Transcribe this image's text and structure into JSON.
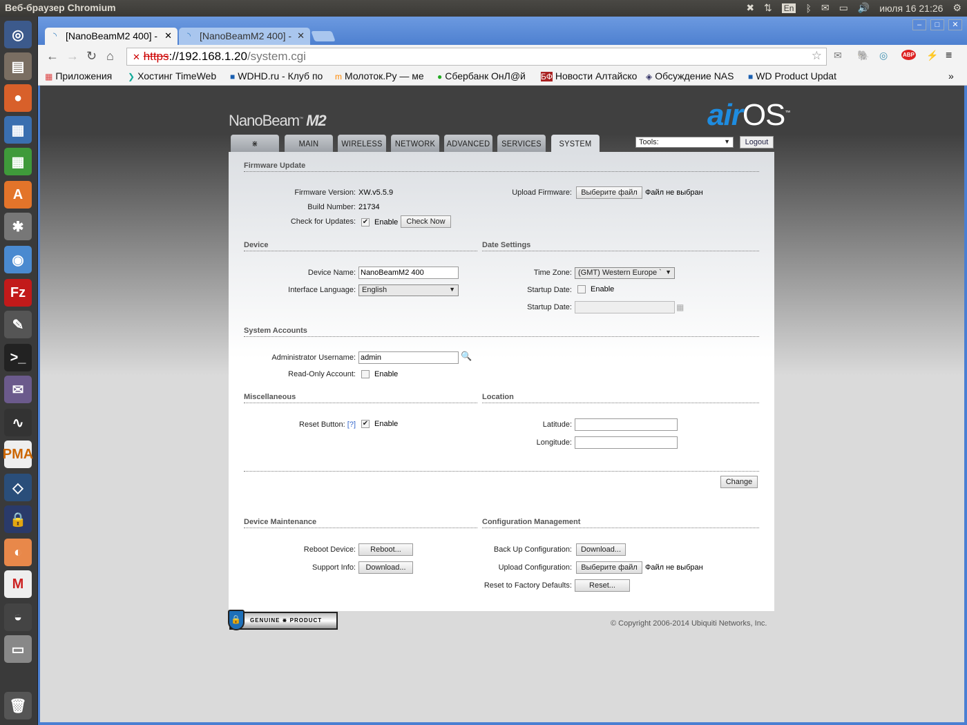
{
  "os": {
    "window_title": "Веб-браузер Chromium",
    "keyboard": "En",
    "clock": "июля 16 21:26"
  },
  "browser": {
    "tabs": [
      {
        "label": "[NanoBeamM2 400] - "
      },
      {
        "label": "[NanoBeamM2 400] - "
      }
    ],
    "url": {
      "scheme": "https",
      "rest_host": "://192.168.1.20",
      "path": "/system.cgi"
    },
    "bookmarks": [
      "Приложения",
      "Хостинг TimeWeb",
      "WDHD.ru - Клуб по",
      "Молоток.Ру — ме",
      "Сбербанк ОнЛ@й",
      "Новости Алтайско",
      "Обсуждение NAS",
      "WD Product Updat"
    ],
    "more": "»"
  },
  "header": {
    "brand": "NanoBeam",
    "brand_model": "M2",
    "logo_air": "air",
    "logo_os": "OS",
    "tm": "™",
    "tabs": [
      "MAIN",
      "WIRELESS",
      "NETWORK",
      "ADVANCED",
      "SERVICES",
      "SYSTEM"
    ],
    "tools": "Tools:",
    "logout": "Logout"
  },
  "firmware": {
    "title": "Firmware Update",
    "version_label": "Firmware Version:",
    "version": "XW.v5.5.9",
    "build_label": "Build Number:",
    "build": "21734",
    "check_label": "Check for Updates:",
    "enable": "Enable",
    "check_now": "Check Now",
    "upload_label": "Upload Firmware:",
    "choose_file": "Выберите файл",
    "no_file": "Файл не выбран"
  },
  "device": {
    "title": "Device",
    "name_label": "Device Name:",
    "name": "NanoBeamM2 400",
    "lang_label": "Interface Language:",
    "lang": "English"
  },
  "date": {
    "title": "Date Settings",
    "tz_label": "Time Zone:",
    "tz": "(GMT) Western Europe `",
    "startup_label": "Startup Date:",
    "enable": "Enable",
    "startup_date_label": "Startup Date:"
  },
  "accounts": {
    "title": "System Accounts",
    "admin_label": "Administrator Username:",
    "admin": "admin",
    "ro_label": "Read-Only Account:",
    "enable": "Enable"
  },
  "misc": {
    "title": "Miscellaneous",
    "reset_label": "Reset Button:",
    "help": "[?]",
    "enable": "Enable"
  },
  "location": {
    "title": "Location",
    "lat_label": "Latitude:",
    "lon_label": "Longitude:"
  },
  "change": "Change",
  "maintenance": {
    "title": "Device Maintenance",
    "reboot_label": "Reboot Device:",
    "reboot": "Reboot...",
    "support_label": "Support Info:",
    "download": "Download..."
  },
  "config": {
    "title": "Configuration Management",
    "backup_label": "Back Up Configuration:",
    "download": "Download...",
    "upload_label": "Upload Configuration:",
    "choose_file": "Выберите файл",
    "no_file": "Файл не выбран",
    "reset_label": "Reset to Factory Defaults:",
    "reset": "Reset..."
  },
  "footer": {
    "badge_left": "GENUINE",
    "badge_right": "PRODUCT",
    "copyright": "© Copyright 2006-2014 Ubiquiti Networks, Inc."
  }
}
